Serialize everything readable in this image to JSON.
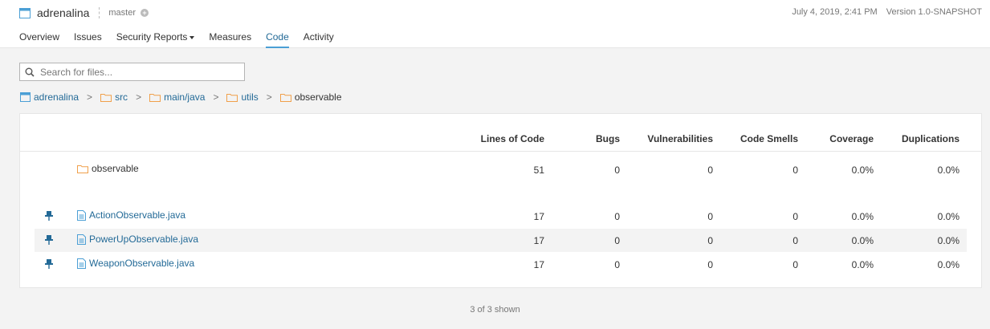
{
  "project": {
    "name": "adrenalina",
    "branch": "master"
  },
  "meta": {
    "date": "July 4, 2019, 2:41 PM",
    "version": "Version 1.0-SNAPSHOT"
  },
  "nav": {
    "overview": "Overview",
    "issues": "Issues",
    "security": "Security Reports",
    "measures": "Measures",
    "code": "Code",
    "activity": "Activity"
  },
  "search": {
    "placeholder": "Search for files..."
  },
  "breadcrumbs": [
    "adrenalina",
    "src",
    "main/java",
    "utils",
    "observable"
  ],
  "table": {
    "headers": {
      "loc": "Lines of Code",
      "bugs": "Bugs",
      "vulns": "Vulnerabilities",
      "smells": "Code Smells",
      "coverage": "Coverage",
      "dups": "Duplications"
    },
    "base": {
      "name": "observable",
      "loc": "51",
      "bugs": "0",
      "vulns": "0",
      "smells": "0",
      "coverage": "0.0%",
      "dups": "0.0%"
    },
    "files": [
      {
        "name": "ActionObservable.java",
        "loc": "17",
        "bugs": "0",
        "vulns": "0",
        "smells": "0",
        "coverage": "0.0%",
        "dups": "0.0%"
      },
      {
        "name": "PowerUpObservable.java",
        "loc": "17",
        "bugs": "0",
        "vulns": "0",
        "smells": "0",
        "coverage": "0.0%",
        "dups": "0.0%"
      },
      {
        "name": "WeaponObservable.java",
        "loc": "17",
        "bugs": "0",
        "vulns": "0",
        "smells": "0",
        "coverage": "0.0%",
        "dups": "0.0%"
      }
    ]
  },
  "footer": {
    "shown": "3 of 3 shown"
  },
  "colors": {
    "link": "#236a97",
    "accent": "#4b9fd5",
    "folder": "#f0a04b"
  }
}
